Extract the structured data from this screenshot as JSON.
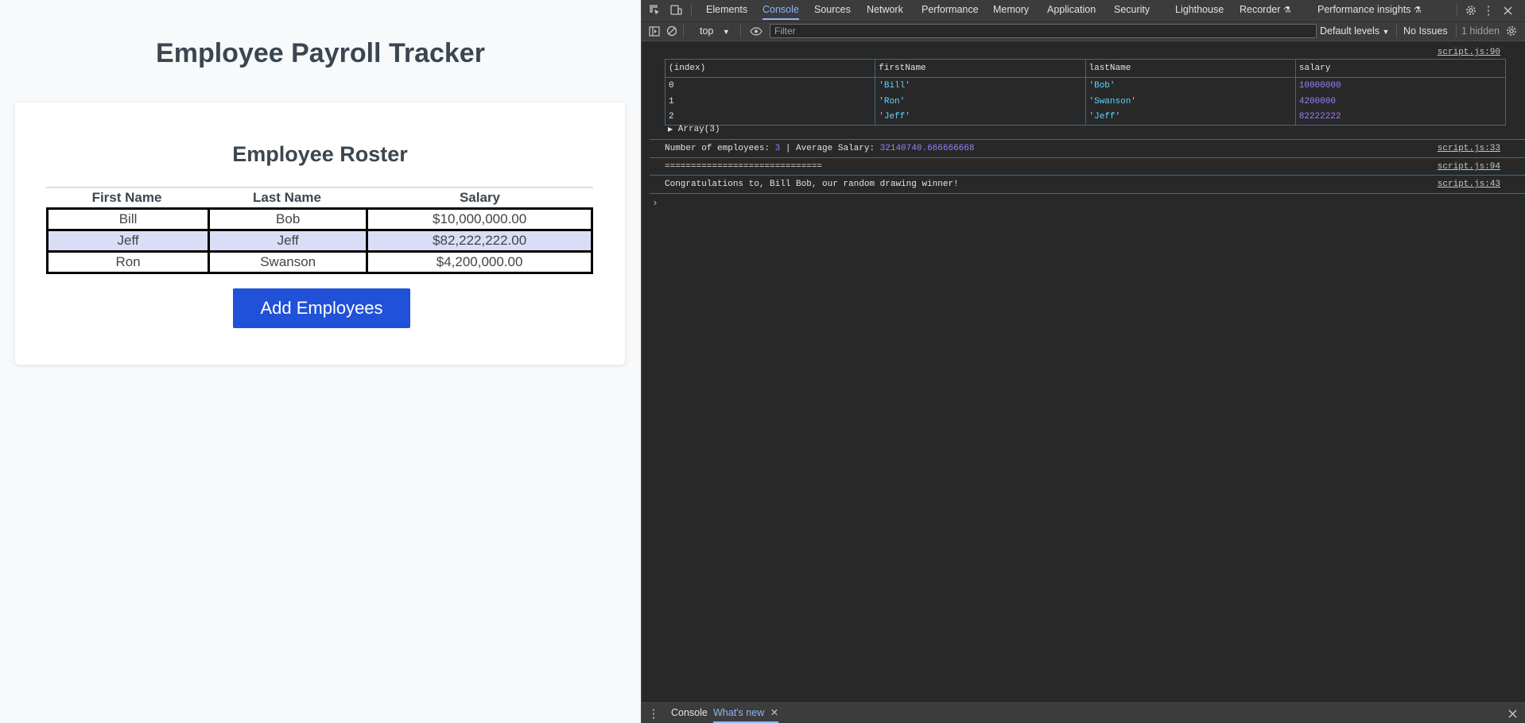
{
  "page": {
    "title": "Employee Payroll Tracker",
    "card_title": "Employee Roster",
    "columns": [
      "First Name",
      "Last Name",
      "Salary"
    ],
    "rows": [
      [
        "Bill",
        "Bob",
        "$10,000,000.00"
      ],
      [
        "Jeff",
        "Jeff",
        "$82,222,222.00"
      ],
      [
        "Ron",
        "Swanson",
        "$4,200,000.00"
      ]
    ],
    "add_button": "Add Employees"
  },
  "devtools": {
    "tabs": [
      "Elements",
      "Console",
      "Sources",
      "Network",
      "Performance",
      "Memory",
      "Application",
      "Security",
      "Lighthouse",
      "Recorder",
      "Performance insights"
    ],
    "active_tab": "Console",
    "toolbar": {
      "context": "top",
      "filter_placeholder": "Filter",
      "levels": "Default levels",
      "issues": "No Issues",
      "hidden": "1 hidden"
    },
    "console": {
      "table_source": "script.js:90",
      "table_headers": [
        "(index)",
        "firstName",
        "lastName",
        "salary"
      ],
      "table_rows": [
        [
          "0",
          "'Bill'",
          "'Bob'",
          "10000000"
        ],
        [
          "1",
          "'Ron'",
          "'Swanson'",
          "4200000"
        ],
        [
          "2",
          "'Jeff'",
          "'Jeff'",
          "82222222"
        ]
      ],
      "array_label": "Array(3)",
      "count_prefix": "Number of employees: ",
      "count_value": "3",
      "avg_prefix": " | Average Salary: ",
      "avg_value": "32140740.666666668",
      "count_source": "script.js:33",
      "separator": "==============================",
      "separator_source": "script.js:94",
      "winner": "Congratulations to, Bill Bob, our random drawing winner!",
      "winner_source": "script.js:43",
      "prompt": "›"
    },
    "drawer": {
      "tabs": [
        "Console",
        "What's new"
      ],
      "active_tab": "What's new"
    }
  }
}
